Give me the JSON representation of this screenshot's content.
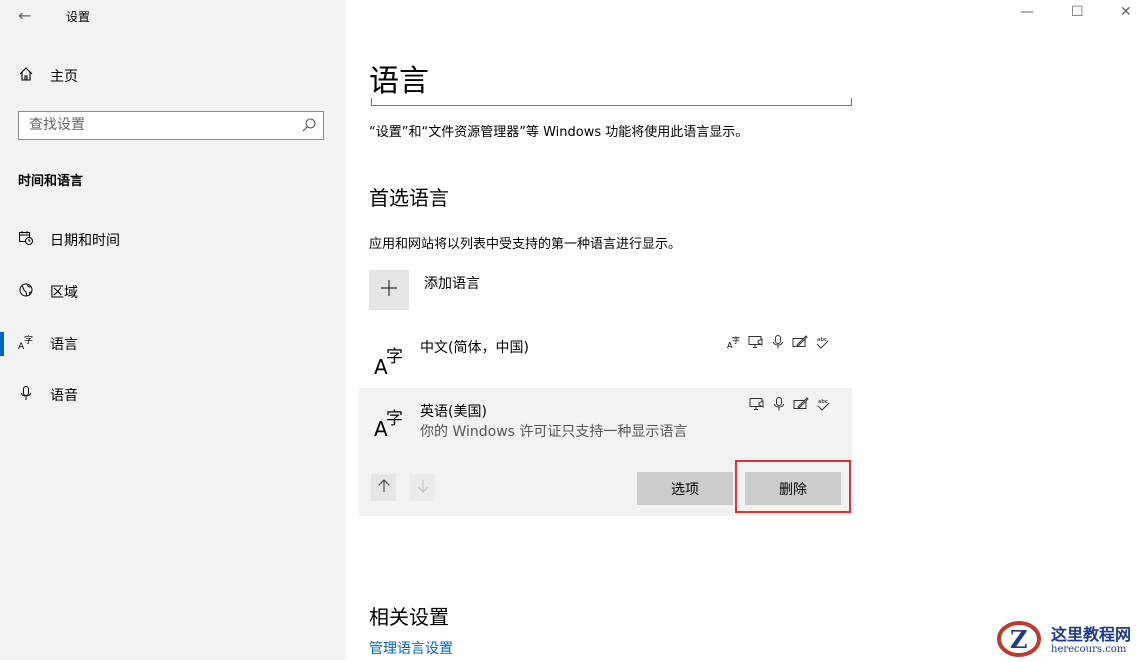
{
  "window": {
    "title": "设置",
    "back_icon": "back-arrow-icon",
    "controls": {
      "minimize": "—",
      "maximize": "☐",
      "close": "✕"
    }
  },
  "sidebar": {
    "home_label": "主页",
    "search_placeholder": "查找设置",
    "section_title": "时间和语言",
    "items": [
      {
        "label": "日期和时间",
        "icon": "calendar-clock-icon"
      },
      {
        "label": "区域",
        "icon": "globe-region-icon"
      },
      {
        "label": "语言",
        "icon": "language-icon",
        "active": true
      },
      {
        "label": "语音",
        "icon": "microphone-icon"
      }
    ],
    "accent": "#0067c0"
  },
  "main": {
    "title": "语言",
    "description": "“设置”和“文件资源管理器”等 Windows 功能将使用此语言显示。",
    "preferred_title": "首选语言",
    "preferred_desc": "应用和网站将以列表中受支持的第一种语言进行显示。",
    "add_language_label": "添加语言",
    "languages": [
      {
        "name": "中文(简体，中国)",
        "features": [
          "language-pack-icon",
          "text-to-speech-icon",
          "speech-recognition-icon",
          "handwriting-icon",
          "spellcheck-icon"
        ]
      },
      {
        "name": "英语(美国)",
        "note": "你的 Windows 许可证只支持一种显示语言",
        "features": [
          "text-to-speech-icon",
          "speech-recognition-icon",
          "handwriting-icon",
          "spellcheck-icon"
        ],
        "options_label": "选项",
        "remove_label": "删除"
      }
    ],
    "highlight_color": "#e0303a",
    "related_title": "相关设置",
    "related_link": "管理语言设置"
  },
  "watermark": {
    "text": "这里教程网",
    "domain": "herecours.com"
  }
}
